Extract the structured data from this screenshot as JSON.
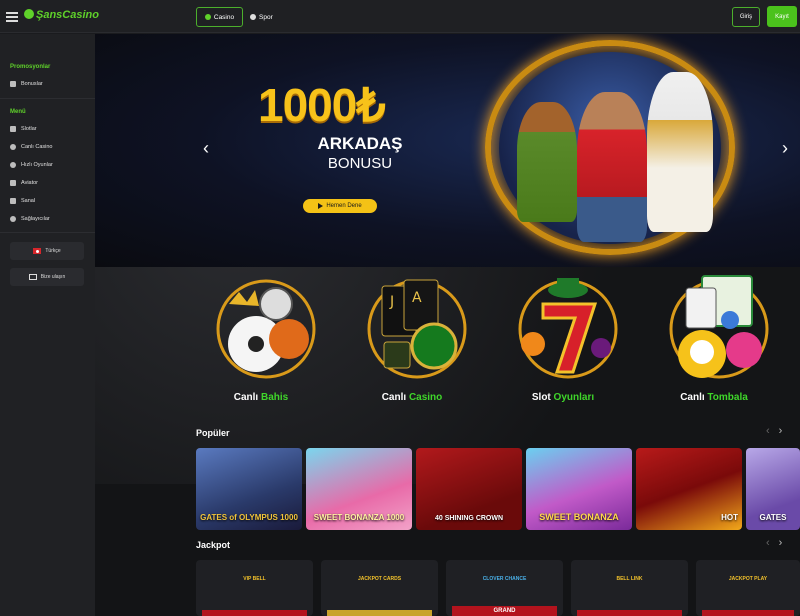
{
  "header": {
    "logo": "ŞansCasino",
    "nav": [
      {
        "label": "Casino"
      },
      {
        "label": "Spor"
      }
    ],
    "login": "Giriş",
    "register": "Kayıt"
  },
  "sidebar": {
    "promo_title": "Promosyonlar",
    "promo_items": [
      {
        "label": "Bonuslar",
        "icon": "gift-icon"
      }
    ],
    "menu_title": "Menü",
    "menu_items": [
      {
        "label": "Slotlar",
        "icon": "slot-icon"
      },
      {
        "label": "Canlı Casino",
        "icon": "chip-icon"
      },
      {
        "label": "Hızlı Oyunlar",
        "icon": "lightning-icon"
      },
      {
        "label": "Aviator",
        "icon": "plane-icon"
      },
      {
        "label": "Sanal",
        "icon": "controller-icon"
      },
      {
        "label": "Sağlayıcılar",
        "icon": "provider-icon"
      }
    ],
    "language": "Türkçe",
    "contact": "Bize ulaşın"
  },
  "hero": {
    "amount": "1000₺",
    "line1": "ARKADAŞ",
    "line2": "BONUSU",
    "cta": "Hemen Dene"
  },
  "categories": [
    {
      "label_a": "Canlı ",
      "label_b": "Bahis"
    },
    {
      "label_a": "Canlı ",
      "label_b": "Casino"
    },
    {
      "label_a": "Slot ",
      "label_b": "Oyunları"
    },
    {
      "label_a": "Canlı ",
      "label_b": "Tombala"
    }
  ],
  "popular": {
    "title": "Popüler",
    "games": [
      {
        "title": "GATES of OLYMPUS 1000"
      },
      {
        "title": "SWEET BONANZA 1000"
      },
      {
        "title": "40 SHINING CROWN"
      },
      {
        "title": "SWEET BONANZA"
      },
      {
        "title": "HOT"
      },
      {
        "title": "GATES"
      }
    ]
  },
  "jackpot": {
    "title": "Jackpot",
    "items": [
      {
        "logo": "VIP BELL"
      },
      {
        "logo": "JACKPOT CARDS"
      },
      {
        "logo": "CLOVER CHANCE",
        "banner": "GRAND"
      },
      {
        "logo": "BELL LINK"
      },
      {
        "logo": "JACKPOT PLAY"
      }
    ]
  },
  "colors": {
    "accent": "#4bc21c",
    "gold": "#f4c216",
    "bg": "#131416"
  }
}
